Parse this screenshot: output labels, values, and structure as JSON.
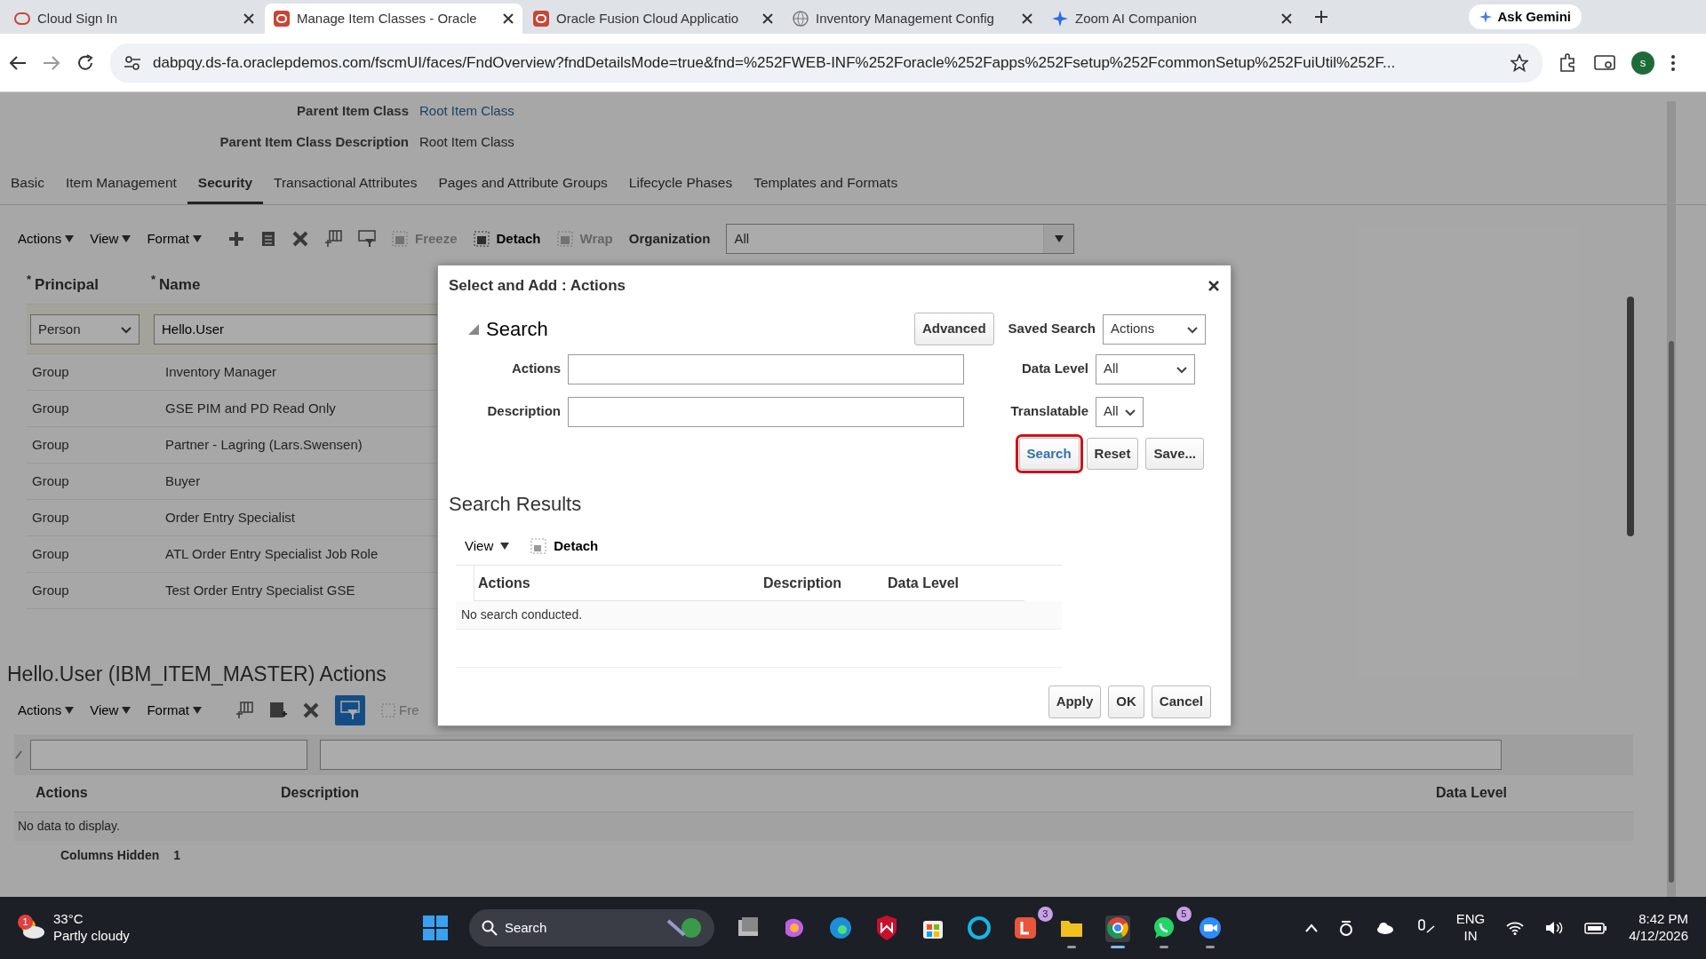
{
  "browser": {
    "tabs": [
      {
        "title": "Cloud Sign In",
        "kind": "ring",
        "selected": false
      },
      {
        "title": "Manage Item Classes - Oracle",
        "kind": "oracle",
        "selected": true
      },
      {
        "title": "Oracle Fusion Cloud Applicatio",
        "kind": "oracle",
        "selected": false
      },
      {
        "title": "Inventory Management Config",
        "kind": "globe",
        "selected": false
      },
      {
        "title": "Zoom AI Companion",
        "kind": "sparkle",
        "selected": false
      }
    ],
    "ask_gemini": "Ask Gemini",
    "url": "dabpqy.ds-fa.oraclepdemos.com/fscmUI/faces/FndOverview?fndDetailsMode=true&fnd=%252FWEB-INF%252Foracle%252Fapps%252Fsetup%252FcommonSetup%252FuiUtil%252F...",
    "profile": "s"
  },
  "page": {
    "header_fields": [
      {
        "label": "Parent Item Class",
        "value": "Root Item Class",
        "kind": "link"
      },
      {
        "label": "Parent Item Class Description",
        "value": "Root Item Class",
        "kind": "text"
      }
    ],
    "tabs": [
      {
        "label": "Basic",
        "selected": false
      },
      {
        "label": "Item Management",
        "selected": false
      },
      {
        "label": "Security",
        "selected": true
      },
      {
        "label": "Transactional Attributes",
        "selected": false
      },
      {
        "label": "Pages and Attribute Groups",
        "selected": false
      },
      {
        "label": "Lifecycle Phases",
        "selected": false
      },
      {
        "label": "Templates and Formats",
        "selected": false
      }
    ],
    "toolbar": {
      "menus": [
        "Actions",
        "View",
        "Format"
      ],
      "buttons": [
        {
          "label": "Freeze",
          "disabled": true
        },
        {
          "label": "Detach",
          "disabled": false
        },
        {
          "label": "Wrap",
          "disabled": true
        }
      ],
      "organization": {
        "label": "Organization",
        "value": "All"
      }
    },
    "table": {
      "columns": [
        {
          "label": "Principal",
          "required_mark": "*"
        },
        {
          "label": "Name",
          "required_mark": "*"
        }
      ],
      "edit_row": {
        "principal": "Person",
        "name": "Hello.User"
      },
      "rows": [
        {
          "principal": "Group",
          "name": "Inventory Manager"
        },
        {
          "principal": "Group",
          "name": "GSE PIM and PD Read Only"
        },
        {
          "principal": "Group",
          "name": "Partner - Lagring (Lars.Swensen)"
        },
        {
          "principal": "Group",
          "name": "Buyer"
        },
        {
          "principal": "Group",
          "name": "Order Entry Specialist"
        },
        {
          "principal": "Group",
          "name": "ATL Order Entry Specialist Job Role"
        },
        {
          "principal": "Group",
          "name": "Test Order Entry Specialist GSE"
        }
      ]
    },
    "actions_section": {
      "title": "Hello.User (IBM_ITEM_MASTER) Actions",
      "menus": [
        "Actions",
        "View",
        "Format"
      ],
      "freeze_partial": "Fre",
      "columns": [
        "Actions",
        "Description",
        "Data Level"
      ],
      "empty": "No data to display.",
      "columns_hidden": {
        "label": "Columns Hidden",
        "count": "1"
      }
    }
  },
  "dialog": {
    "title": "Select and Add : Actions",
    "search": {
      "heading": "Search",
      "expanded": true,
      "advanced": "Advanced",
      "saved_search": {
        "label": "Saved Search",
        "value": "Actions"
      },
      "fields": [
        {
          "label": "Actions"
        },
        {
          "label": "Description"
        }
      ],
      "selects": [
        {
          "label": "Data Level",
          "value": "All"
        },
        {
          "label": "Translatable",
          "value": "All"
        }
      ],
      "buttons": [
        {
          "label": "Search",
          "highlighted": true
        },
        {
          "label": "Reset",
          "highlighted": false
        },
        {
          "label": "Save...",
          "highlighted": false
        }
      ]
    },
    "results": {
      "heading": "Search Results",
      "view": "View",
      "detach": "Detach",
      "columns": [
        "Actions",
        "Description",
        "Data Level"
      ],
      "empty": "No search conducted."
    },
    "footer": [
      "Apply",
      "OK",
      "Cancel"
    ]
  },
  "taskbar": {
    "weather": {
      "temp": "33°C",
      "condition": "Partly cloudy",
      "badge": "1"
    },
    "search": "Search",
    "apps": [
      {
        "running": false,
        "active": false
      },
      {
        "running": false,
        "active": false
      },
      {
        "running": false,
        "active": false
      },
      {
        "running": false,
        "active": false
      },
      {
        "running": false,
        "active": false
      },
      {
        "running": false,
        "active": false
      },
      {
        "running": false,
        "active": false,
        "badge": "3"
      },
      {
        "running": true,
        "active": false
      },
      {
        "running": true,
        "active": true
      },
      {
        "running": true,
        "active": false,
        "badge": "5"
      },
      {
        "running": true,
        "active": false
      }
    ],
    "language": [
      "ENG",
      "IN"
    ],
    "time": "8:42 PM",
    "date": "4/12/2026"
  }
}
